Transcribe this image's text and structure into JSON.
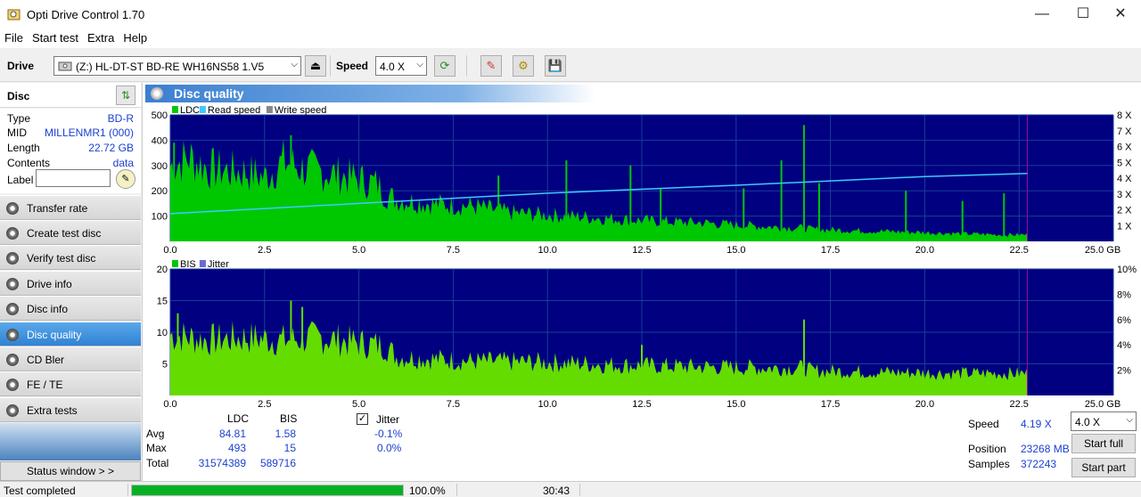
{
  "window": {
    "title": "Opti Drive Control 1.70",
    "minimize": "—",
    "maximize": "☐",
    "close": "✕"
  },
  "menu": [
    "File",
    "Start test",
    "Extra",
    "Help"
  ],
  "toolbar": {
    "drive_label": "Drive",
    "drive_value": "(Z:)   HL-DT-ST BD-RE  WH16NS58 1.V5",
    "speed_label": "Speed",
    "speed_value": "4.0 X",
    "eject": "⏏",
    "refresh": "⟳",
    "erase": "✎",
    "settings": "⚙",
    "save": "💾"
  },
  "disc": {
    "title": "Disc",
    "type_label": "Type",
    "type_value": "BD-R",
    "mid_label": "MID",
    "mid_value": "MILLENMR1 (000)",
    "length_label": "Length",
    "length_value": "22.72 GB",
    "contents_label": "Contents",
    "contents_value": "data",
    "label_label": "Label",
    "label_value": ""
  },
  "nav": [
    "Transfer rate",
    "Create test disc",
    "Verify test disc",
    "Drive info",
    "Disc info",
    "Disc quality",
    "CD Bler",
    "FE / TE",
    "Extra tests"
  ],
  "active_nav": "Disc quality",
  "status_window_button": "Status window > >",
  "panel_title": "Disc quality",
  "chart_data": [
    {
      "type": "area",
      "legend": [
        "LDC",
        "Read speed",
        "Write speed"
      ],
      "x_ticks": [
        "0.0",
        "2.5",
        "5.0",
        "7.5",
        "10.0",
        "12.5",
        "15.0",
        "17.5",
        "20.0",
        "22.5",
        "25.0 GB"
      ],
      "y_left_ticks": [
        "500",
        "400",
        "300",
        "200",
        "100"
      ],
      "y_right_ticks": [
        "8 X",
        "7 X",
        "6 X",
        "5 X",
        "4 X",
        "3 X",
        "2 X",
        "1 X"
      ],
      "xlim": [
        0,
        25
      ],
      "ylim": [
        0,
        500
      ],
      "y2lim": [
        0,
        8
      ],
      "ldc": {
        "x": [
          0,
          0.5,
          1,
          1.5,
          2,
          2.5,
          3,
          3.5,
          4,
          4.5,
          5,
          5.5,
          5.7,
          6,
          7,
          8,
          9,
          10,
          11,
          12,
          13,
          14,
          15,
          16,
          16.8,
          17,
          18,
          19,
          20,
          21,
          22,
          22.72
        ],
        "y": [
          340,
          380,
          330,
          320,
          315,
          290,
          360,
          330,
          315,
          300,
          280,
          260,
          210,
          190,
          170,
          160,
          130,
          120,
          110,
          100,
          90,
          85,
          75,
          65,
          60,
          55,
          50,
          45,
          40,
          35,
          30,
          30
        ]
      },
      "ldc_spikes": {
        "x": [
          0.1,
          3.2,
          8.7,
          10.5,
          12.2,
          13,
          15.2,
          16.2,
          16.8,
          17.2,
          19.5,
          21,
          22.1
        ],
        "y": [
          390,
          420,
          260,
          320,
          300,
          210,
          210,
          320,
          460,
          230,
          200,
          160,
          190
        ]
      },
      "read_speed": {
        "x": [
          0,
          5,
          10,
          15,
          20,
          22.72
        ],
        "y": [
          1.75,
          2.4,
          3.05,
          3.55,
          4.1,
          4.3
        ]
      }
    },
    {
      "type": "area",
      "legend": [
        "BIS",
        "Jitter"
      ],
      "x_ticks": [
        "0.0",
        "2.5",
        "5.0",
        "7.5",
        "10.0",
        "12.5",
        "15.0",
        "17.5",
        "20.0",
        "22.5",
        "25.0 GB"
      ],
      "y_left_ticks": [
        "20",
        "15",
        "10",
        "5"
      ],
      "y_right_ticks": [
        "10%",
        "8%",
        "6%",
        "4%",
        "2%"
      ],
      "xlim": [
        0,
        25
      ],
      "ylim": [
        0,
        20
      ],
      "y2lim": [
        0,
        10
      ],
      "bis": {
        "x": [
          0,
          1,
          2,
          3,
          4,
          5,
          5.7,
          6,
          8,
          10,
          12,
          14,
          16,
          16.8,
          17,
          19,
          21,
          22.72
        ],
        "y": [
          11,
          10,
          10.5,
          10,
          10.5,
          9.5,
          9,
          7,
          6.2,
          6,
          5.5,
          5.2,
          5,
          5,
          4.5,
          4.2,
          4,
          4
        ]
      },
      "bis_spikes": {
        "x": [
          0.2,
          3.2,
          3.5,
          12.5,
          16.8
        ],
        "y": [
          13,
          15,
          14,
          8,
          12
        ]
      }
    }
  ],
  "stats": {
    "col_ldc": "LDC",
    "col_bis": "BIS",
    "col_jitter": "Jitter",
    "avg_label": "Avg",
    "avg_ldc": "84.81",
    "avg_bis": "1.58",
    "avg_jitter": "-0.1%",
    "max_label": "Max",
    "max_ldc": "493",
    "max_bis": "15",
    "max_jitter": "0.0%",
    "total_label": "Total",
    "total_ldc": "31574389",
    "total_bis": "589716",
    "jitter_checked": true
  },
  "right": {
    "speed_label": "Speed",
    "speed_value": "4.19 X",
    "speed_select": "4.0 X",
    "position_label": "Position",
    "position_value": "23268 MB",
    "samples_label": "Samples",
    "samples_value": "372243",
    "start_full": "Start full",
    "start_part": "Start part"
  },
  "status": {
    "text": "Test completed",
    "progress_text": "100.0%",
    "progress": 1.0,
    "time": "30:43"
  },
  "colors": {
    "plot_bg": "#000080",
    "ldc": "#00c800",
    "bis": "#64dc00",
    "read_speed": "#40c8ff",
    "grid": "#1a3c99",
    "accent": "#3b7fd0"
  }
}
